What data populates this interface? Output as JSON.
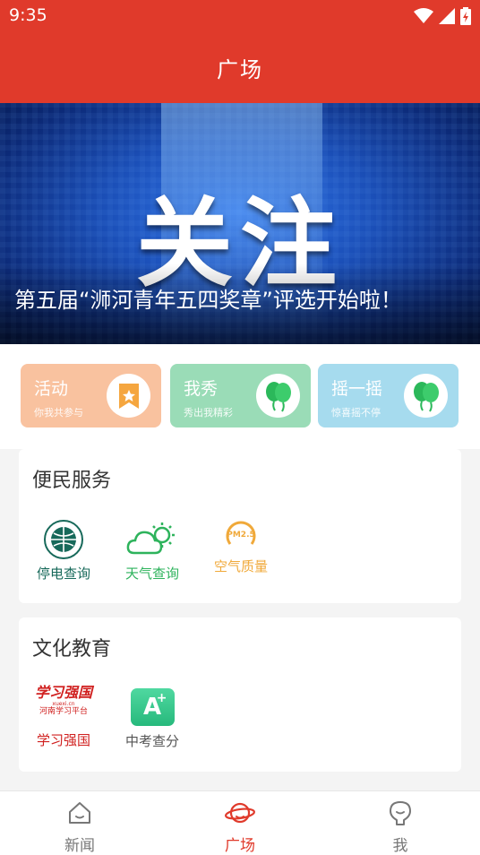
{
  "status_bar": {
    "time": "9:35"
  },
  "header": {
    "title": "广场"
  },
  "banner": {
    "big_word": "关注",
    "caption": "第五届“浉河青年五四奖章”评选开始啦！"
  },
  "quick_cards": [
    {
      "title": "活动",
      "subtitle": "你我共参与",
      "icon": "bookmark-star-icon",
      "color": "#f9c29f"
    },
    {
      "title": "我秀",
      "subtitle": "秀出我精彩",
      "icon": "balloons-icon",
      "color": "#9adcb7"
    },
    {
      "title": "摇一摇",
      "subtitle": "惊喜摇不停",
      "icon": "balloons-icon",
      "color": "#a6dbee"
    }
  ],
  "services": {
    "title": "便民服务",
    "items": [
      {
        "label": "停电查询",
        "icon": "state-grid-logo-icon",
        "color": "#17695a"
      },
      {
        "label": "天气查询",
        "icon": "cloud-sun-icon",
        "color": "#2eb35c"
      },
      {
        "label": "空气质量",
        "icon": "pm25-icon",
        "color": "#f0a93a",
        "icon_text": "PM2.5"
      }
    ]
  },
  "education": {
    "title": "文化教育",
    "items": [
      {
        "label": "学习强国",
        "icon": "xuexi-logo-icon",
        "color": "#d0201f",
        "logo_text": "学习强国",
        "logo_sub": "河南学习平台",
        "logo_url": "xuexi.cn"
      },
      {
        "label": "中考查分",
        "icon": "grade-a-plus-icon",
        "color": "#555555",
        "icon_text": "A"
      }
    ]
  },
  "bottom_nav": {
    "items": [
      {
        "label": "新闻",
        "icon": "home-icon",
        "active": false
      },
      {
        "label": "广场",
        "icon": "planet-icon",
        "active": true
      },
      {
        "label": "我",
        "icon": "bulb-person-icon",
        "active": false
      }
    ],
    "active_color": "#e03a2b",
    "inactive_color": "#777777"
  }
}
